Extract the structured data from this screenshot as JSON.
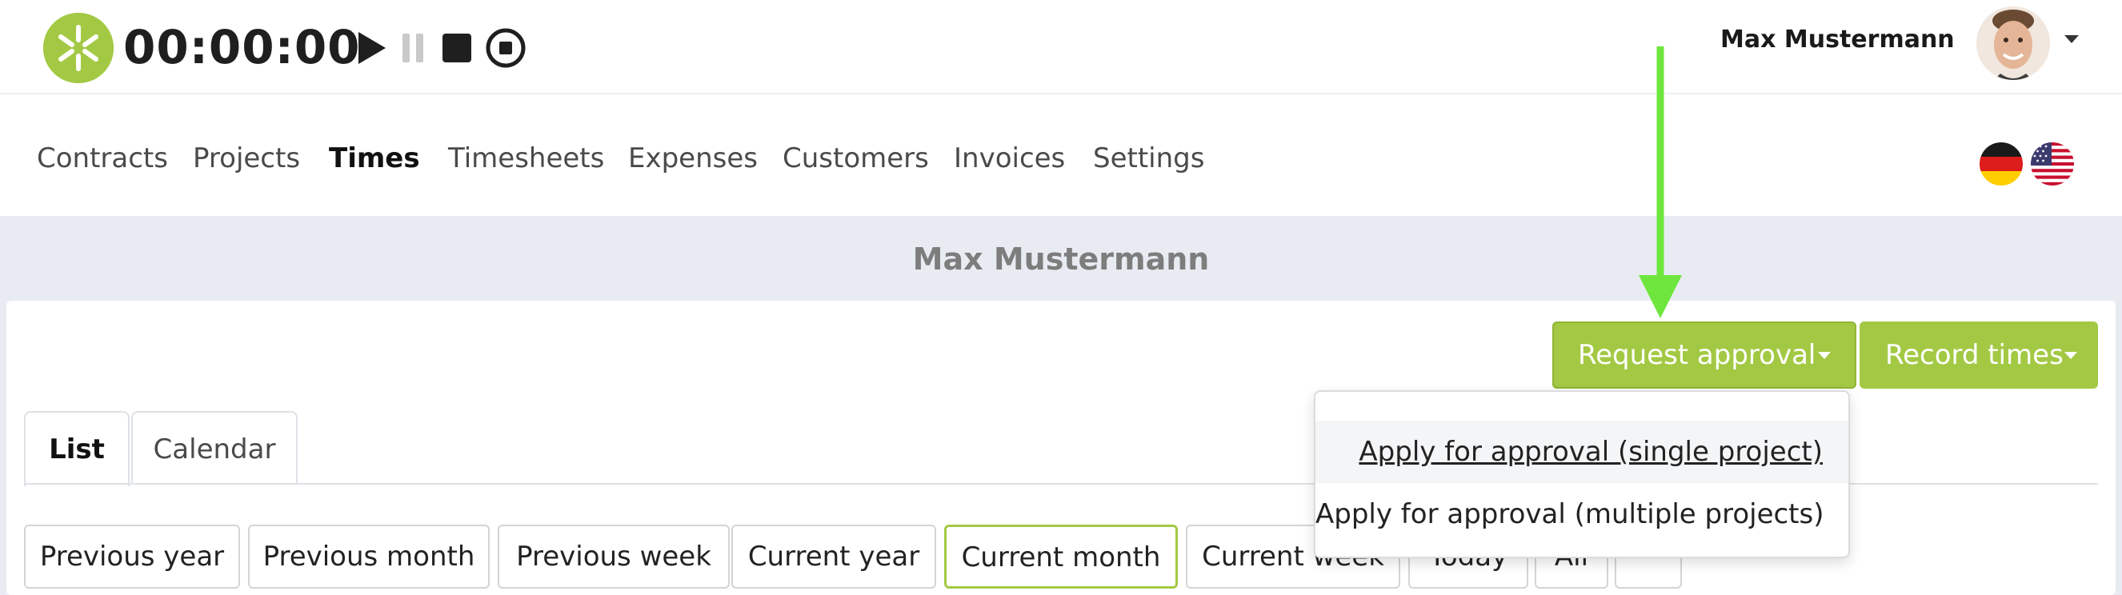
{
  "timer": {
    "display": "00:00:00",
    "controls": [
      "play-icon",
      "pause-icon",
      "stop-icon",
      "record-icon"
    ]
  },
  "user": {
    "name": "Max Mustermann"
  },
  "nav": {
    "items": [
      {
        "label": "Contracts",
        "active": false
      },
      {
        "label": "Projects",
        "active": false
      },
      {
        "label": "Times",
        "active": true
      },
      {
        "label": "Timesheets",
        "active": false
      },
      {
        "label": "Expenses",
        "active": false
      },
      {
        "label": "Customers",
        "active": false
      },
      {
        "label": "Invoices",
        "active": false
      },
      {
        "label": "Settings",
        "active": false
      }
    ],
    "languages": [
      "german-flag-icon",
      "us-flag-icon"
    ]
  },
  "page": {
    "title": "Max Mustermann"
  },
  "actions": {
    "request_approval": "Request approval",
    "record_times": "Record times"
  },
  "approval_menu": {
    "items": [
      "Apply for approval (single project)",
      "Apply for approval (multiple projects)"
    ]
  },
  "tabs": [
    {
      "label": "List",
      "active": true
    },
    {
      "label": "Calendar",
      "active": false
    }
  ],
  "period_filters": {
    "items": [
      "Previous year",
      "Previous month",
      "Previous week",
      "Current year",
      "Current month",
      "Current week",
      "Today",
      "All",
      ""
    ],
    "selected": "Current month"
  },
  "colors": {
    "accent": "#a3c944",
    "annotation_arrow": "#6ee63e",
    "page_background": "#e8ecf2"
  }
}
